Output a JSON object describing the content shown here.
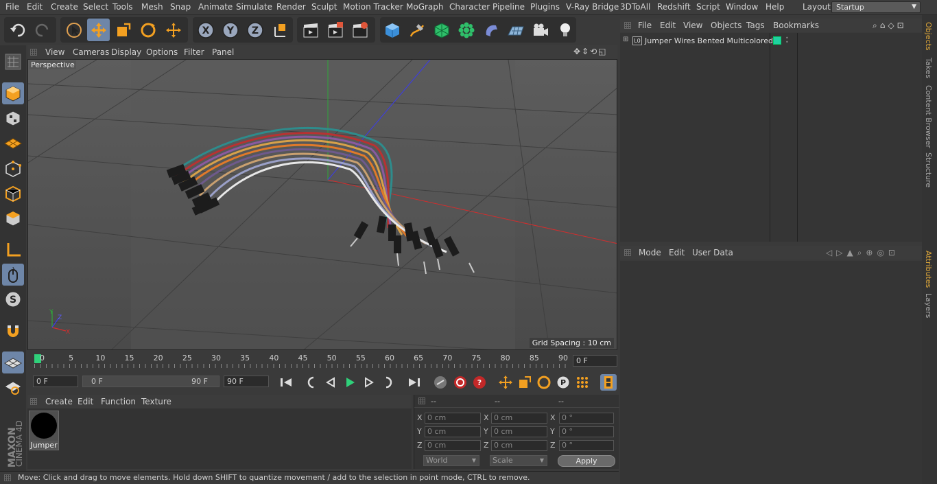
{
  "menu": [
    "File",
    "Edit",
    "Create",
    "Select",
    "Tools",
    "Mesh",
    "Snap",
    "Animate",
    "Simulate",
    "Render",
    "Sculpt",
    "Motion Tracker",
    "MoGraph",
    "Character",
    "Pipeline",
    "Plugins",
    "V-Ray Bridge",
    "3DToAll",
    "Redshift",
    "Script",
    "Window",
    "Help"
  ],
  "layout": {
    "label": "Layout:",
    "value": "Startup"
  },
  "viewport": {
    "menu": [
      "View",
      "Cameras",
      "Display",
      "Options",
      "Filter",
      "Panel"
    ],
    "label": "Perspective",
    "grid_spacing": "Grid Spacing : 10 cm"
  },
  "timeline": {
    "ticks": [
      "0",
      "5",
      "10",
      "15",
      "20",
      "25",
      "30",
      "35",
      "40",
      "45",
      "50",
      "55",
      "60",
      "65",
      "70",
      "75",
      "80",
      "85",
      "90"
    ],
    "current_frame": "0 F",
    "start": "0 F",
    "range_start": "0 F",
    "range_end": "90 F",
    "end": "90 F"
  },
  "material_manager": {
    "menu": [
      "Create",
      "Edit",
      "Function",
      "Texture"
    ],
    "material_name": "Jumper"
  },
  "coordinates": {
    "headers": [
      "--",
      "--",
      "--"
    ],
    "rows": [
      {
        "axis": "X",
        "pos": "0 cm",
        "size": "0 cm",
        "rot": "0 °"
      },
      {
        "axis": "Y",
        "pos": "0 cm",
        "size": "0 cm",
        "rot": "0 °"
      },
      {
        "axis": "Z",
        "pos": "0 cm",
        "size": "0 cm",
        "rot": "0 °"
      }
    ],
    "mode": "World",
    "scale": "Scale",
    "apply": "Apply"
  },
  "status": "Move: Click and drag to move elements. Hold down SHIFT to quantize movement / add to the selection in point mode, CTRL to remove.",
  "object_manager": {
    "menu": [
      "File",
      "Edit",
      "View",
      "Objects",
      "Tags",
      "Bookmarks"
    ],
    "object_name": "Jumper Wires Bented Multicolored",
    "layer_badge": "L0"
  },
  "attribute_manager": {
    "menu": [
      "Mode",
      "Edit",
      "User Data"
    ]
  },
  "right_tabs": [
    "Objects",
    "Takes",
    "Content Browser",
    "Structure",
    "Attributes",
    "Layers"
  ],
  "brand": {
    "maxon": "MAXON",
    "cinema": "CINEMA 4D"
  },
  "colors": {
    "accent": "#6e86a8",
    "active_tab": "#e0a93a",
    "object_tag": "#1fd1a0"
  }
}
